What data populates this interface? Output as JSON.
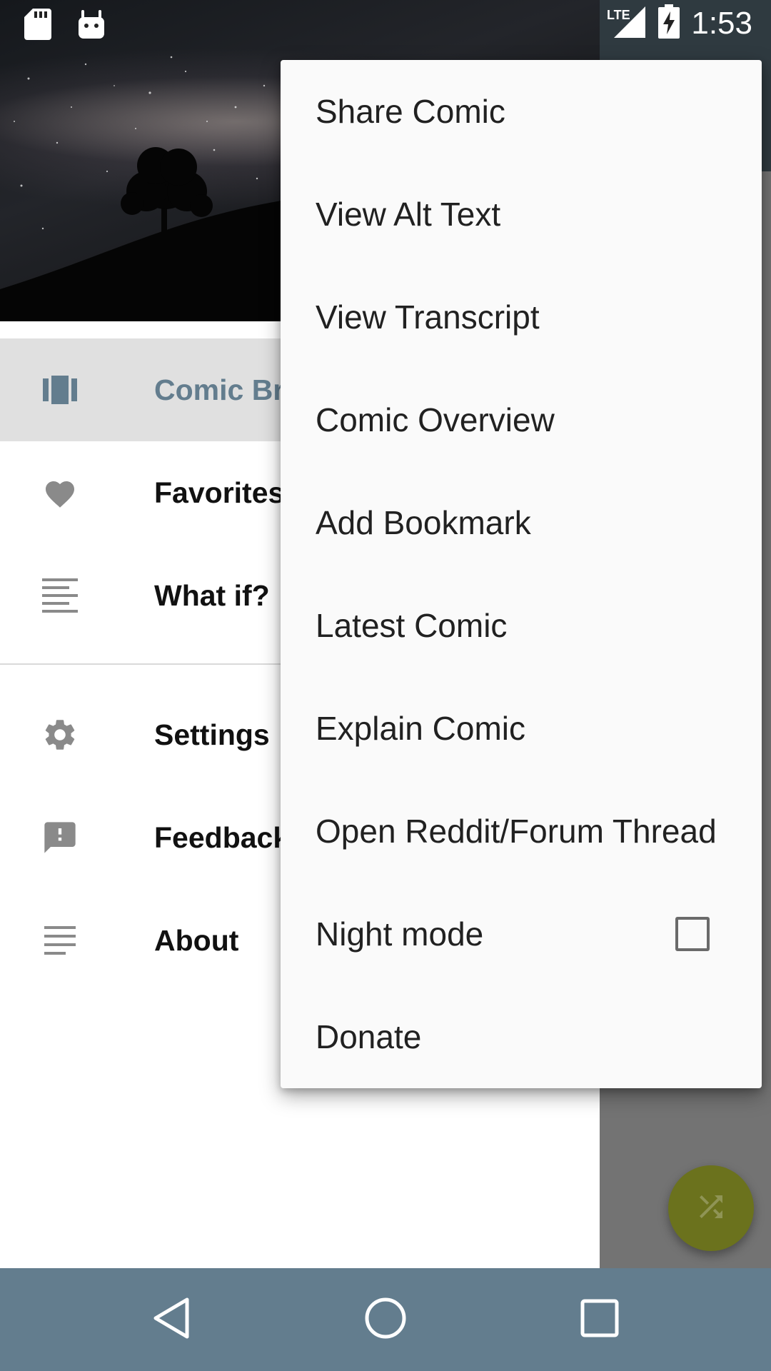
{
  "status_bar": {
    "time": "1:53",
    "network": "LTE",
    "icons": [
      "sd-card-icon",
      "android-debug-icon",
      "lte-signal-icon",
      "battery-charging-icon"
    ]
  },
  "drawer": {
    "header_image": "night-sky-tree-image",
    "items": [
      {
        "label": "Comic Bro",
        "icon": "comic-browser-icon",
        "active": true
      },
      {
        "label": "Favorites",
        "icon": "heart-icon"
      },
      {
        "label": "What if?",
        "icon": "article-icon"
      },
      {
        "label": "Settings",
        "icon": "gear-icon"
      },
      {
        "label": "Feedback",
        "icon": "feedback-icon"
      },
      {
        "label": "About",
        "icon": "about-icon"
      }
    ]
  },
  "overflow_menu": {
    "items": [
      {
        "label": "Share Comic"
      },
      {
        "label": "View Alt Text"
      },
      {
        "label": "View Transcript"
      },
      {
        "label": "Comic Overview"
      },
      {
        "label": "Add Bookmark"
      },
      {
        "label": "Latest Comic"
      },
      {
        "label": "Explain Comic"
      },
      {
        "label": "Open Reddit/Forum Thread"
      },
      {
        "label": "Night mode",
        "checkbox": true,
        "checked": false
      },
      {
        "label": "Donate"
      }
    ]
  },
  "fab": {
    "icon": "shuffle-icon"
  },
  "nav_bar": {
    "buttons": [
      "back-icon",
      "home-icon",
      "recents-icon"
    ]
  },
  "colors": {
    "primary": "#637d8e",
    "fab": "#6b721d",
    "menu_bg": "#fafafa",
    "drawer_active_bg": "#e0e0e0"
  }
}
